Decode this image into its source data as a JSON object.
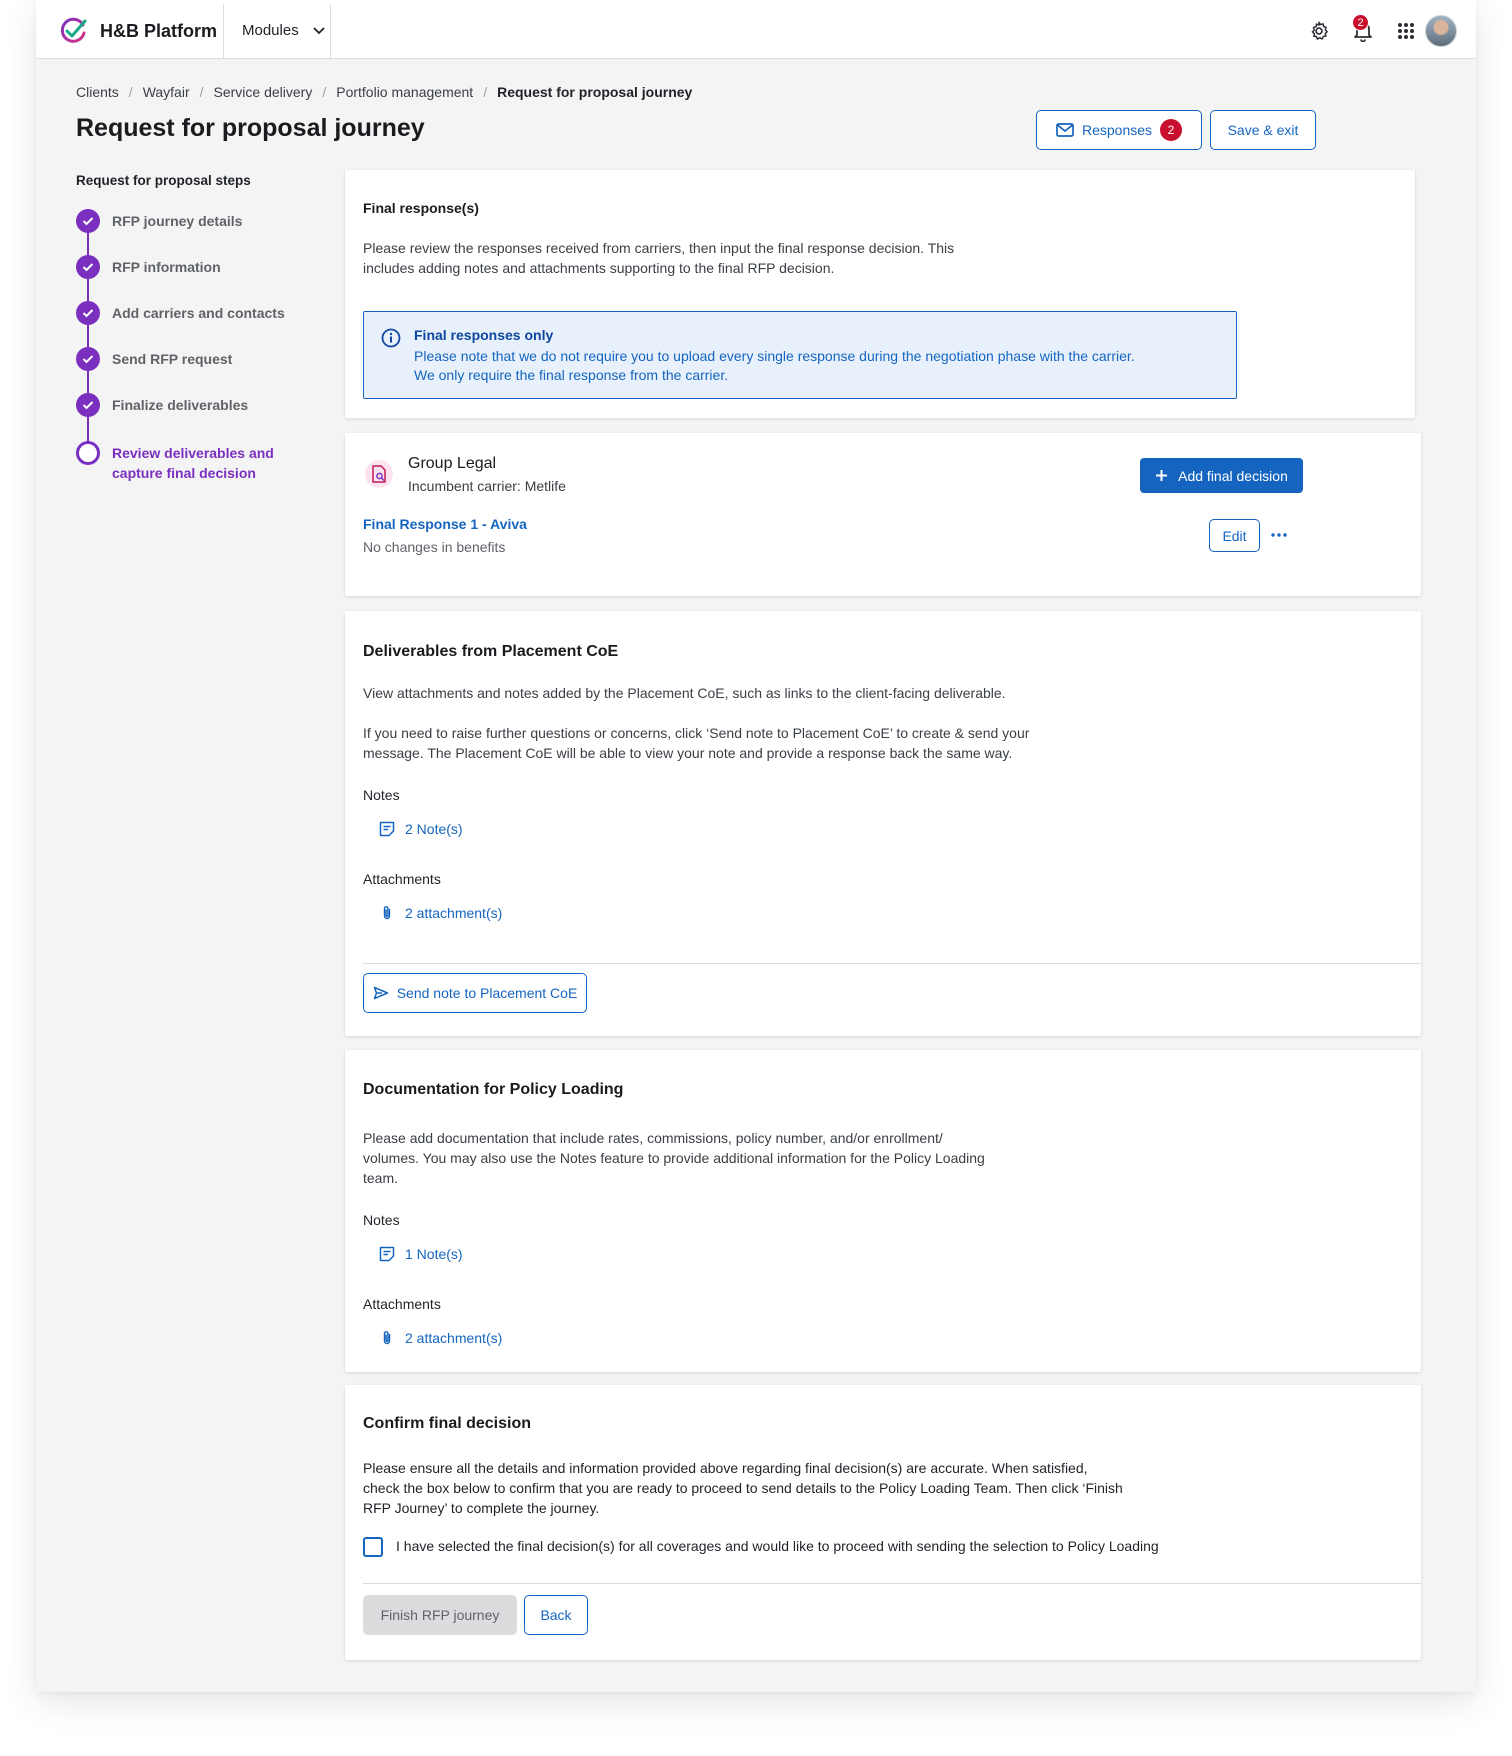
{
  "app": {
    "title": "H&B Platform",
    "modules_label": "Modules",
    "notification_count": "2"
  },
  "breadcrumb": [
    "Clients",
    "Wayfair",
    "Service delivery",
    "Portfolio management",
    "Request for proposal journey"
  ],
  "page": {
    "title": "Request for proposal journey",
    "responses_label": "Responses",
    "responses_count": "2",
    "save_exit_label": "Save & exit"
  },
  "steps": {
    "title": "Request for proposal steps",
    "items": [
      {
        "label": "RFP journey details",
        "state": "done"
      },
      {
        "label": "RFP information",
        "state": "done"
      },
      {
        "label": "Add carriers and contacts",
        "state": "done"
      },
      {
        "label": "Send RFP request",
        "state": "done"
      },
      {
        "label": "Finalize deliverables",
        "state": "done"
      },
      {
        "label": "Review deliverables and capture final decision",
        "state": "current"
      }
    ]
  },
  "final_responses": {
    "title": "Final response(s)",
    "description": "Please review the responses received from carriers, then input the final response decision. This includes adding notes and attachments supporting to the final RFP decision.",
    "info_title": "Final responses only",
    "info_text": "Please note that we do not require you to upload every single response during the negotiation phase with the carrier. We only require the final response from the carrier."
  },
  "coverage": {
    "name": "Group Legal",
    "incumbent": "Incumbent carrier: Metlife",
    "add_decision_label": "Add final decision",
    "response_title": "Final Response 1 - Aviva",
    "response_subtitle": "No changes in benefits",
    "edit_label": "Edit"
  },
  "deliverables": {
    "title": "Deliverables from Placement CoE",
    "para1": "View attachments and notes added by the Placement CoE, such as links to the client-facing deliverable.",
    "para2": "If you need to raise further questions or concerns, click ‘Send note to Placement CoE’ to create & send your message. The Placement CoE will be able to view your note and provide a response back the same way.",
    "notes_label": "Notes",
    "notes_link": "2 Note(s)",
    "attachments_label": "Attachments",
    "attachments_link": "2 attachment(s)",
    "send_note_label": "Send note to Placement CoE"
  },
  "documentation": {
    "title": "Documentation for Policy Loading",
    "para": "Please add documentation that include rates, commissions, policy number, and/or enrollment/ volumes. You may also use the Notes feature to provide additional information for the Policy Loading team.",
    "notes_label": "Notes",
    "notes_link": "1 Note(s)",
    "attachments_label": "Attachments",
    "attachments_link": "2 attachment(s)"
  },
  "confirm": {
    "title": "Confirm final decision",
    "para": "Please ensure all the details and information provided above regarding final decision(s) are accurate.  When satisfied, check the box below to confirm that you are ready to proceed to send details to the Policy Loading Team. Then click ‘Finish RFP Journey’ to complete the journey.",
    "checkbox_label": "I have selected the final decision(s) for all coverages and would like to proceed with sending the selection to Policy Loading",
    "checked": false,
    "finish_label": "Finish RFP journey",
    "back_label": "Back"
  },
  "colors": {
    "primary": "#1565c0",
    "accent": "#7b2fbe",
    "badge": "#c8102e"
  }
}
